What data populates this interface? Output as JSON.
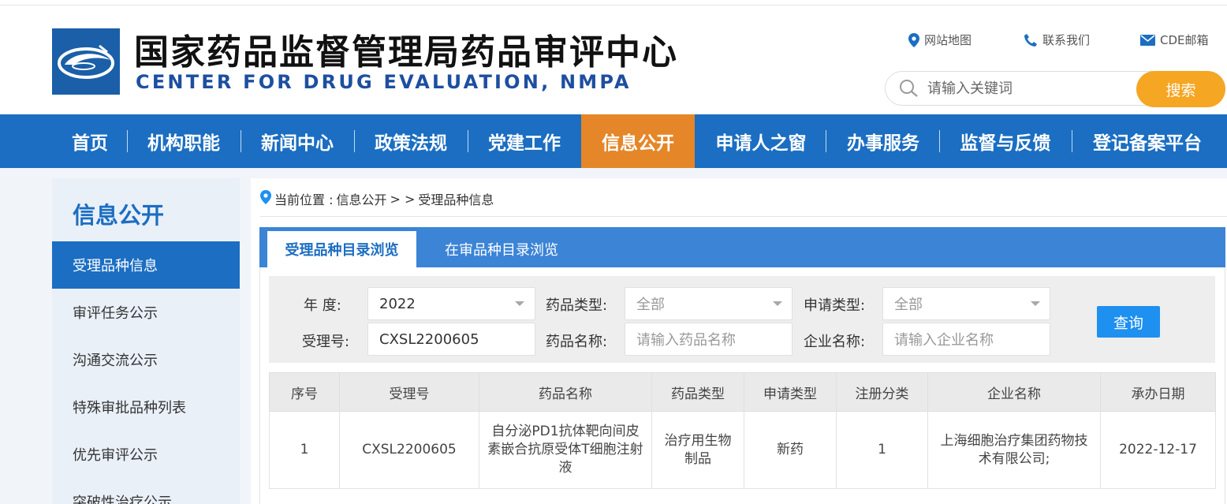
{
  "header": {
    "title": "国家药品监督管理局药品审评中心",
    "subtitle": "CENTER FOR DRUG EVALUATION, NMPA",
    "links": [
      {
        "label": "网站地图",
        "icon": "location-pin-icon"
      },
      {
        "label": "联系我们",
        "icon": "phone-icon"
      },
      {
        "label": "CDE邮箱",
        "icon": "mail-icon"
      }
    ],
    "search": {
      "placeholder": "请输入关键词",
      "button_label": "搜索"
    }
  },
  "nav": {
    "items": [
      "首页",
      "机构职能",
      "新闻中心",
      "政策法规",
      "党建工作",
      "信息公开",
      "申请人之窗",
      "办事服务",
      "监督与反馈",
      "登记备案平台"
    ],
    "active_item": "信息公开"
  },
  "sidebar": {
    "title": "信息公开",
    "items": [
      "受理品种信息",
      "审评任务公示",
      "沟通交流公示",
      "特殊审批品种列表",
      "优先审评公示",
      "突破性治疗公示"
    ],
    "active_item": "受理品种信息"
  },
  "breadcrumb": {
    "prefix": "当前位置 : ",
    "section": "信息公开",
    "separator": " > > ",
    "current": "受理品种信息"
  },
  "tabs": [
    {
      "label": "受理品种目录浏览",
      "active": true
    },
    {
      "label": "在审品种目录浏览",
      "active": false
    }
  ],
  "filters": {
    "year_label": "年   度:",
    "year_value": "2022",
    "drug_type_label": "药品类型:",
    "drug_type_value": "全部",
    "apply_type_label": "申请类型:",
    "apply_type_value": "全部",
    "accept_no_label": "受理号:",
    "accept_no_value": "CXSL2200605",
    "drug_name_label": "药品名称:",
    "drug_name_placeholder": "请输入药品名称",
    "company_label": "企业名称:",
    "company_placeholder": "请输入企业名称",
    "query_button": "查询"
  },
  "table": {
    "headers": [
      "序号",
      "受理号",
      "药品名称",
      "药品类型",
      "申请类型",
      "注册分类",
      "企业名称",
      "承办日期"
    ],
    "rows": [
      [
        "1",
        "CXSL2200605",
        "自分泌PD1抗体靶向间皮素嵌合抗原受体T细胞注射液",
        "治疗用生物制品",
        "新药",
        "1",
        "上海细胞治疗集团药物技术有限公司;",
        "2022-12-17"
      ]
    ]
  },
  "colors": {
    "nav_blue": "#1b6ec2",
    "nav_active_orange": "#e58628",
    "search_orange": "#f5a623",
    "query_blue": "#1e90f0",
    "subtitle_blue": "#1d4fa0"
  }
}
